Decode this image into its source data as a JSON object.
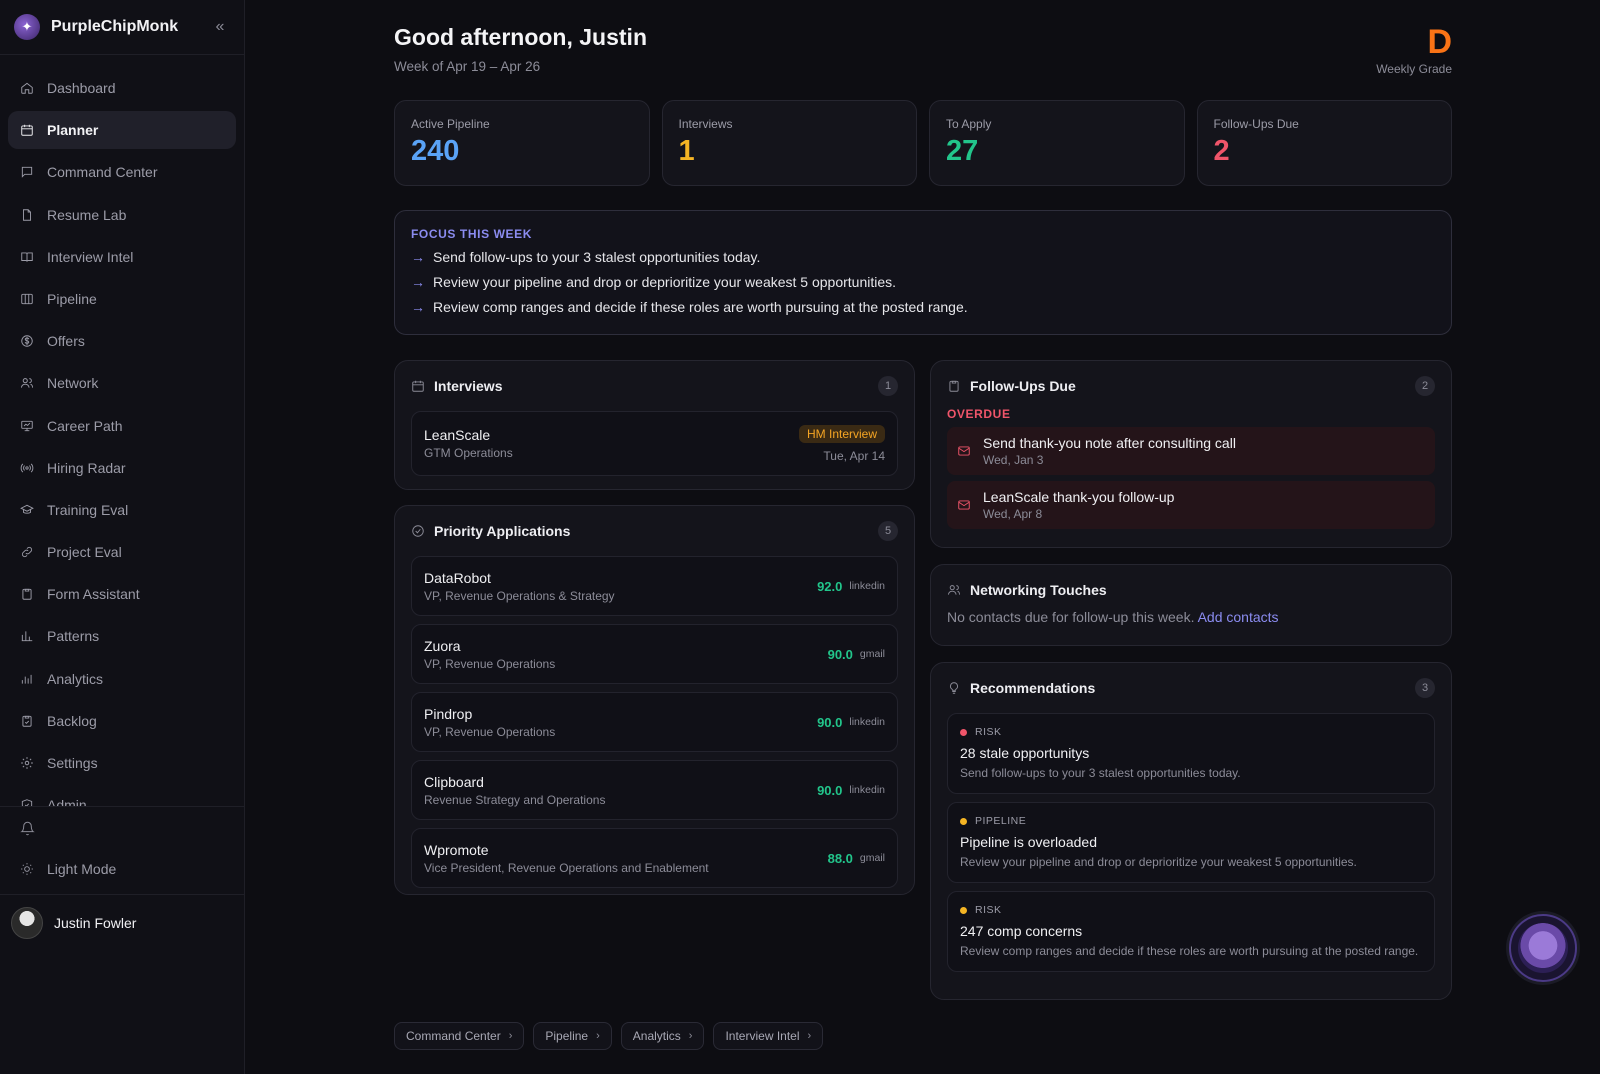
{
  "brand": {
    "name": "PurpleChipMonk"
  },
  "sidebar": {
    "items": [
      {
        "label": "Dashboard",
        "icon": "home-icon",
        "active": false
      },
      {
        "label": "Planner",
        "icon": "calendar-icon",
        "active": true
      },
      {
        "label": "Command Center",
        "icon": "chat-icon",
        "active": false
      },
      {
        "label": "Resume Lab",
        "icon": "file-icon",
        "active": false
      },
      {
        "label": "Interview Intel",
        "icon": "book-icon",
        "active": false
      },
      {
        "label": "Pipeline",
        "icon": "columns-icon",
        "active": false
      },
      {
        "label": "Offers",
        "icon": "dollar-icon",
        "active": false
      },
      {
        "label": "Network",
        "icon": "users-icon",
        "active": false
      },
      {
        "label": "Career Path",
        "icon": "presentation-icon",
        "active": false
      },
      {
        "label": "Hiring Radar",
        "icon": "radio-icon",
        "active": false
      },
      {
        "label": "Training Eval",
        "icon": "graduation-cap-icon",
        "active": false
      },
      {
        "label": "Project Eval",
        "icon": "link-icon",
        "active": false
      },
      {
        "label": "Form Assistant",
        "icon": "clipboard-icon",
        "active": false
      },
      {
        "label": "Patterns",
        "icon": "bar-chart-icon",
        "active": false
      },
      {
        "label": "Analytics",
        "icon": "analytics-icon",
        "active": false
      },
      {
        "label": "Backlog",
        "icon": "clipboard-check-icon",
        "active": false
      },
      {
        "label": "Settings",
        "icon": "gear-icon",
        "active": false
      },
      {
        "label": "Admin",
        "icon": "shield-icon",
        "active": false
      }
    ],
    "light_mode": "Light Mode",
    "user_name": "Justin Fowler"
  },
  "header": {
    "greeting": "Good afternoon, Justin",
    "week": "Week of Apr 19 – Apr 26",
    "grade": "D",
    "grade_label": "Weekly Grade"
  },
  "stats": [
    {
      "label": "Active Pipeline",
      "value": "240",
      "color": "#5aa3f7"
    },
    {
      "label": "Interviews",
      "value": "1",
      "color": "#f5b524"
    },
    {
      "label": "To Apply",
      "value": "27",
      "color": "#22c58b"
    },
    {
      "label": "Follow-Ups Due",
      "value": "2",
      "color": "#f0556a"
    }
  ],
  "focus": {
    "title": "FOCUS THIS WEEK",
    "items": [
      "Send follow-ups to your 3 stalest opportunities today.",
      "Review your pipeline and drop or deprioritize your weakest 5 opportunities.",
      "Review comp ranges and decide if these roles are worth pursuing at the posted range."
    ]
  },
  "interviews": {
    "title": "Interviews",
    "count": "1",
    "items": [
      {
        "company": "LeanScale",
        "role": "GTM Operations",
        "badge": "HM Interview",
        "date": "Tue, Apr 14"
      }
    ]
  },
  "priority": {
    "title": "Priority Applications",
    "count": "5",
    "items": [
      {
        "company": "DataRobot",
        "role": "VP, Revenue Operations & Strategy",
        "score": "92.0",
        "source": "linkedin"
      },
      {
        "company": "Zuora",
        "role": "VP, Revenue Operations",
        "score": "90.0",
        "source": "gmail"
      },
      {
        "company": "Pindrop",
        "role": "VP, Revenue Operations",
        "score": "90.0",
        "source": "linkedin"
      },
      {
        "company": "Clipboard",
        "role": "Revenue Strategy and Operations",
        "score": "90.0",
        "source": "linkedin"
      },
      {
        "company": "Wpromote",
        "role": "Vice President, Revenue Operations and Enablement",
        "score": "88.0",
        "source": "gmail"
      }
    ]
  },
  "followups": {
    "title": "Follow-Ups Due",
    "count": "2",
    "overdue_label": "OVERDUE",
    "items": [
      {
        "title": "Send thank-you note after consulting call",
        "date": "Wed, Jan 3"
      },
      {
        "title": "LeanScale thank-you follow-up",
        "date": "Wed, Apr 8"
      }
    ]
  },
  "networking": {
    "title": "Networking Touches",
    "text": "No contacts due for follow-up this week.",
    "link": "Add contacts"
  },
  "recommendations": {
    "title": "Recommendations",
    "count": "3",
    "items": [
      {
        "tag": "RISK",
        "dot_color": "#f0556a",
        "title": "28 stale opportunitys",
        "desc": "Send follow-ups to your 3 stalest opportunities today."
      },
      {
        "tag": "PIPELINE",
        "dot_color": "#f5b524",
        "title": "Pipeline is overloaded",
        "desc": "Review your pipeline and drop or deprioritize your weakest 5 opportunities."
      },
      {
        "tag": "RISK",
        "dot_color": "#f5b524",
        "title": "247 comp concerns",
        "desc": "Review comp ranges and decide if these roles are worth pursuing at the posted range."
      }
    ]
  },
  "quick_links": [
    "Command Center",
    "Pipeline",
    "Analytics",
    "Interview Intel"
  ]
}
